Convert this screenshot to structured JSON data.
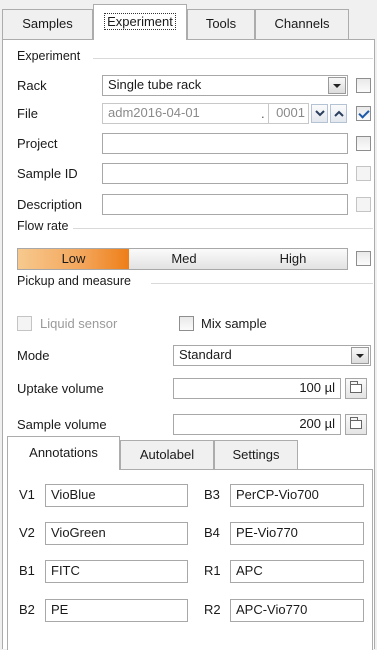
{
  "tabs": [
    "Samples",
    "Experiment",
    "Tools",
    "Channels"
  ],
  "experiment": {
    "group_label": "Experiment",
    "rack": {
      "label": "Rack",
      "value": "Single tube rack",
      "checked": false
    },
    "file": {
      "label": "File",
      "value": "adm2016-04-01",
      "separator": ".",
      "number": "0001",
      "checked": true
    },
    "project": {
      "label": "Project",
      "value": "",
      "checked": false
    },
    "sample_id": {
      "label": "Sample ID",
      "value": "",
      "checked": false
    },
    "description": {
      "label": "Description",
      "value": "",
      "checked": false
    }
  },
  "flow_rate": {
    "group_label": "Flow rate",
    "options": [
      "Low",
      "Med",
      "High"
    ],
    "selected": "Low",
    "checked": false
  },
  "pickup": {
    "group_label": "Pickup and measure",
    "liquid_sensor": {
      "label": "Liquid sensor",
      "checked": false,
      "enabled": false
    },
    "mix_sample": {
      "label": "Mix sample",
      "checked": false
    },
    "mode": {
      "label": "Mode",
      "value": "Standard"
    },
    "uptake": {
      "label": "Uptake volume",
      "value": "100 µl"
    },
    "sample_volume": {
      "label": "Sample volume",
      "value": "200 µl"
    }
  },
  "subtabs": [
    "Annotations",
    "Autolabel",
    "Settings"
  ],
  "annotations": [
    {
      "channel": "V1",
      "value": "VioBlue"
    },
    {
      "channel": "B3",
      "value": "PerCP-Vio700"
    },
    {
      "channel": "V2",
      "value": "VioGreen"
    },
    {
      "channel": "B4",
      "value": "PE-Vio770"
    },
    {
      "channel": "B1",
      "value": "FITC"
    },
    {
      "channel": "R1",
      "value": "APC"
    },
    {
      "channel": "B2",
      "value": "PE"
    },
    {
      "channel": "R2",
      "value": "APC-Vio770"
    }
  ],
  "colors": {
    "accent": "#f08a24",
    "checkmark": "#1e5aa8",
    "panel": "#ffffff",
    "window": "#f0f0f0"
  }
}
